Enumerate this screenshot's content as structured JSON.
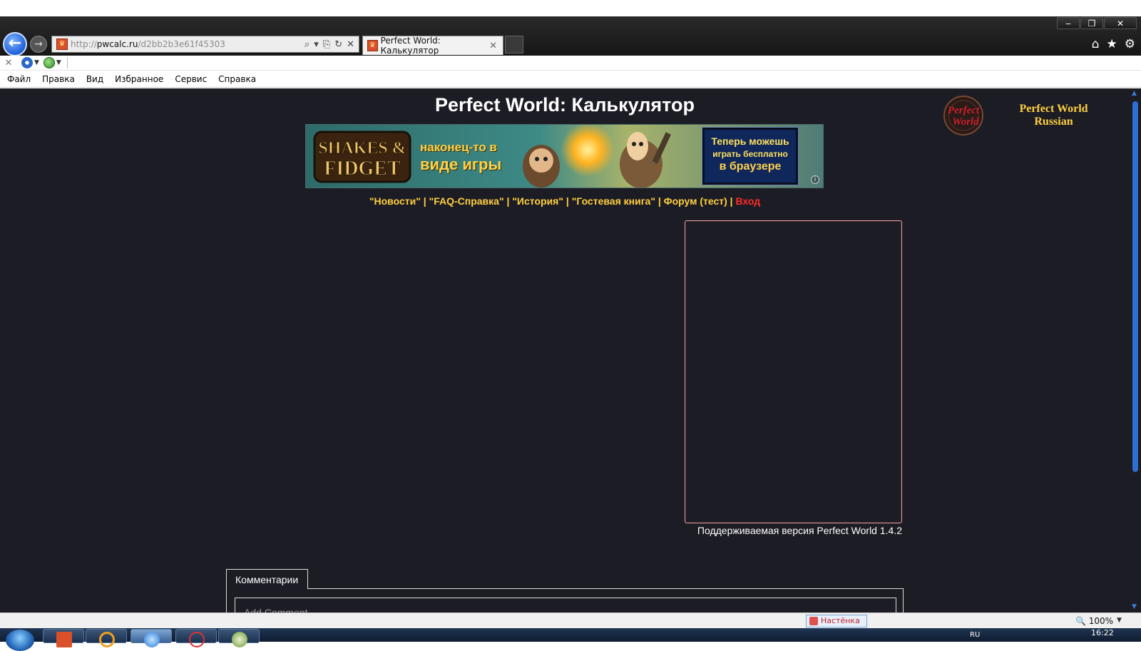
{
  "window": {
    "controls": {
      "minimize": "‒",
      "restore": "❐",
      "close": "✕"
    }
  },
  "addressbar": {
    "url_proto": "http://",
    "url_host": "pwcalc.ru",
    "url_path": "/d2bb2b3e61f45303",
    "tools": [
      "⌕",
      "▾",
      "⎘",
      "↻",
      "✕"
    ]
  },
  "tab": {
    "title": "Perfect World: Калькулятор",
    "close": "✕"
  },
  "chrome_right": {
    "home": "⌂",
    "favorites": "★",
    "tools": "⚙"
  },
  "cmdbar": {
    "close": "✕"
  },
  "menubar": {
    "items": [
      "Файл",
      "Правка",
      "Вид",
      "Избранное",
      "Сервис",
      "Справка"
    ]
  },
  "page": {
    "title": "Perfect World: Калькулятор",
    "logo_text_line1": "Perfect World",
    "logo_text_line2": "Russian",
    "banner": {
      "logo_line1": "SHAKES &",
      "logo_line2": "FIDGET",
      "mid_line1": "наконец-то в",
      "mid_line2": "виде игры",
      "box_line1": "Теперь можешь",
      "box_line2": "играть бесплатно",
      "box_line3": "в браузере",
      "info": "i"
    },
    "nav": {
      "news": "\"Новости\"",
      "faq": "\"FAQ-Справка\"",
      "history": "\"История\"",
      "guestbook": "\"Гостевая книга\"",
      "forum": "Форум (тест)",
      "login": "Вход",
      "separator": " | "
    },
    "version": "Поддерживаемая версия Perfect World 1.4.2",
    "comments_tab": "Комментарии",
    "comment_placeholder": "Add Comment"
  },
  "statusbar": {
    "nastenka": "Настёнка",
    "zoom": "100%",
    "zoom_icon": "🔍"
  },
  "taskbar": {
    "lang": "RU",
    "time": "16:22"
  }
}
